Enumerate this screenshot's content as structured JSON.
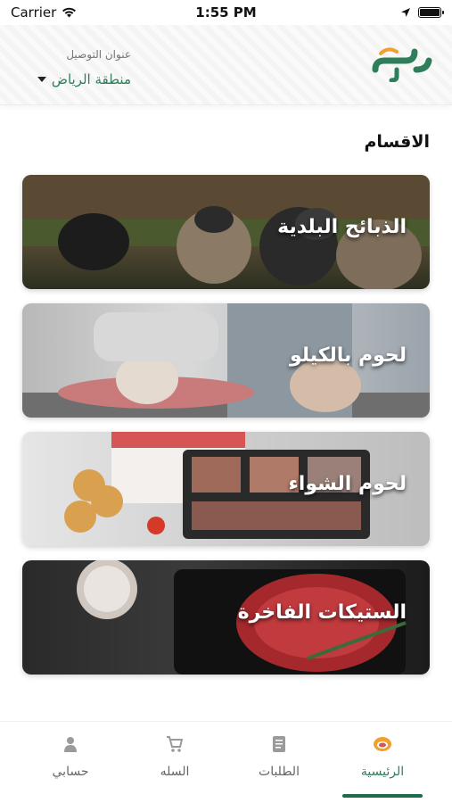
{
  "status_bar": {
    "carrier": "Carrier",
    "time": "1:55 PM"
  },
  "header": {
    "logo_text": "طازج",
    "address_label": "عنوان التوصيل",
    "region": "منطقة الرياض"
  },
  "section_title": "الاقسام",
  "categories": [
    {
      "label": "الذبائح البلدية"
    },
    {
      "label": "لحوم بالكيلو"
    },
    {
      "label": "لحوم الشواء"
    },
    {
      "label": "الستيكات الفاخرة"
    }
  ],
  "bottom_nav": [
    {
      "label": "الرئيسية",
      "icon": "home-logo-icon",
      "active": true
    },
    {
      "label": "الطلبات",
      "icon": "orders-icon",
      "active": false
    },
    {
      "label": "السله",
      "icon": "cart-icon",
      "active": false
    },
    {
      "label": "حسابي",
      "icon": "account-icon",
      "active": false
    }
  ],
  "colors": {
    "brand_green": "#2e7d5b",
    "brand_orange": "#f0a030"
  }
}
